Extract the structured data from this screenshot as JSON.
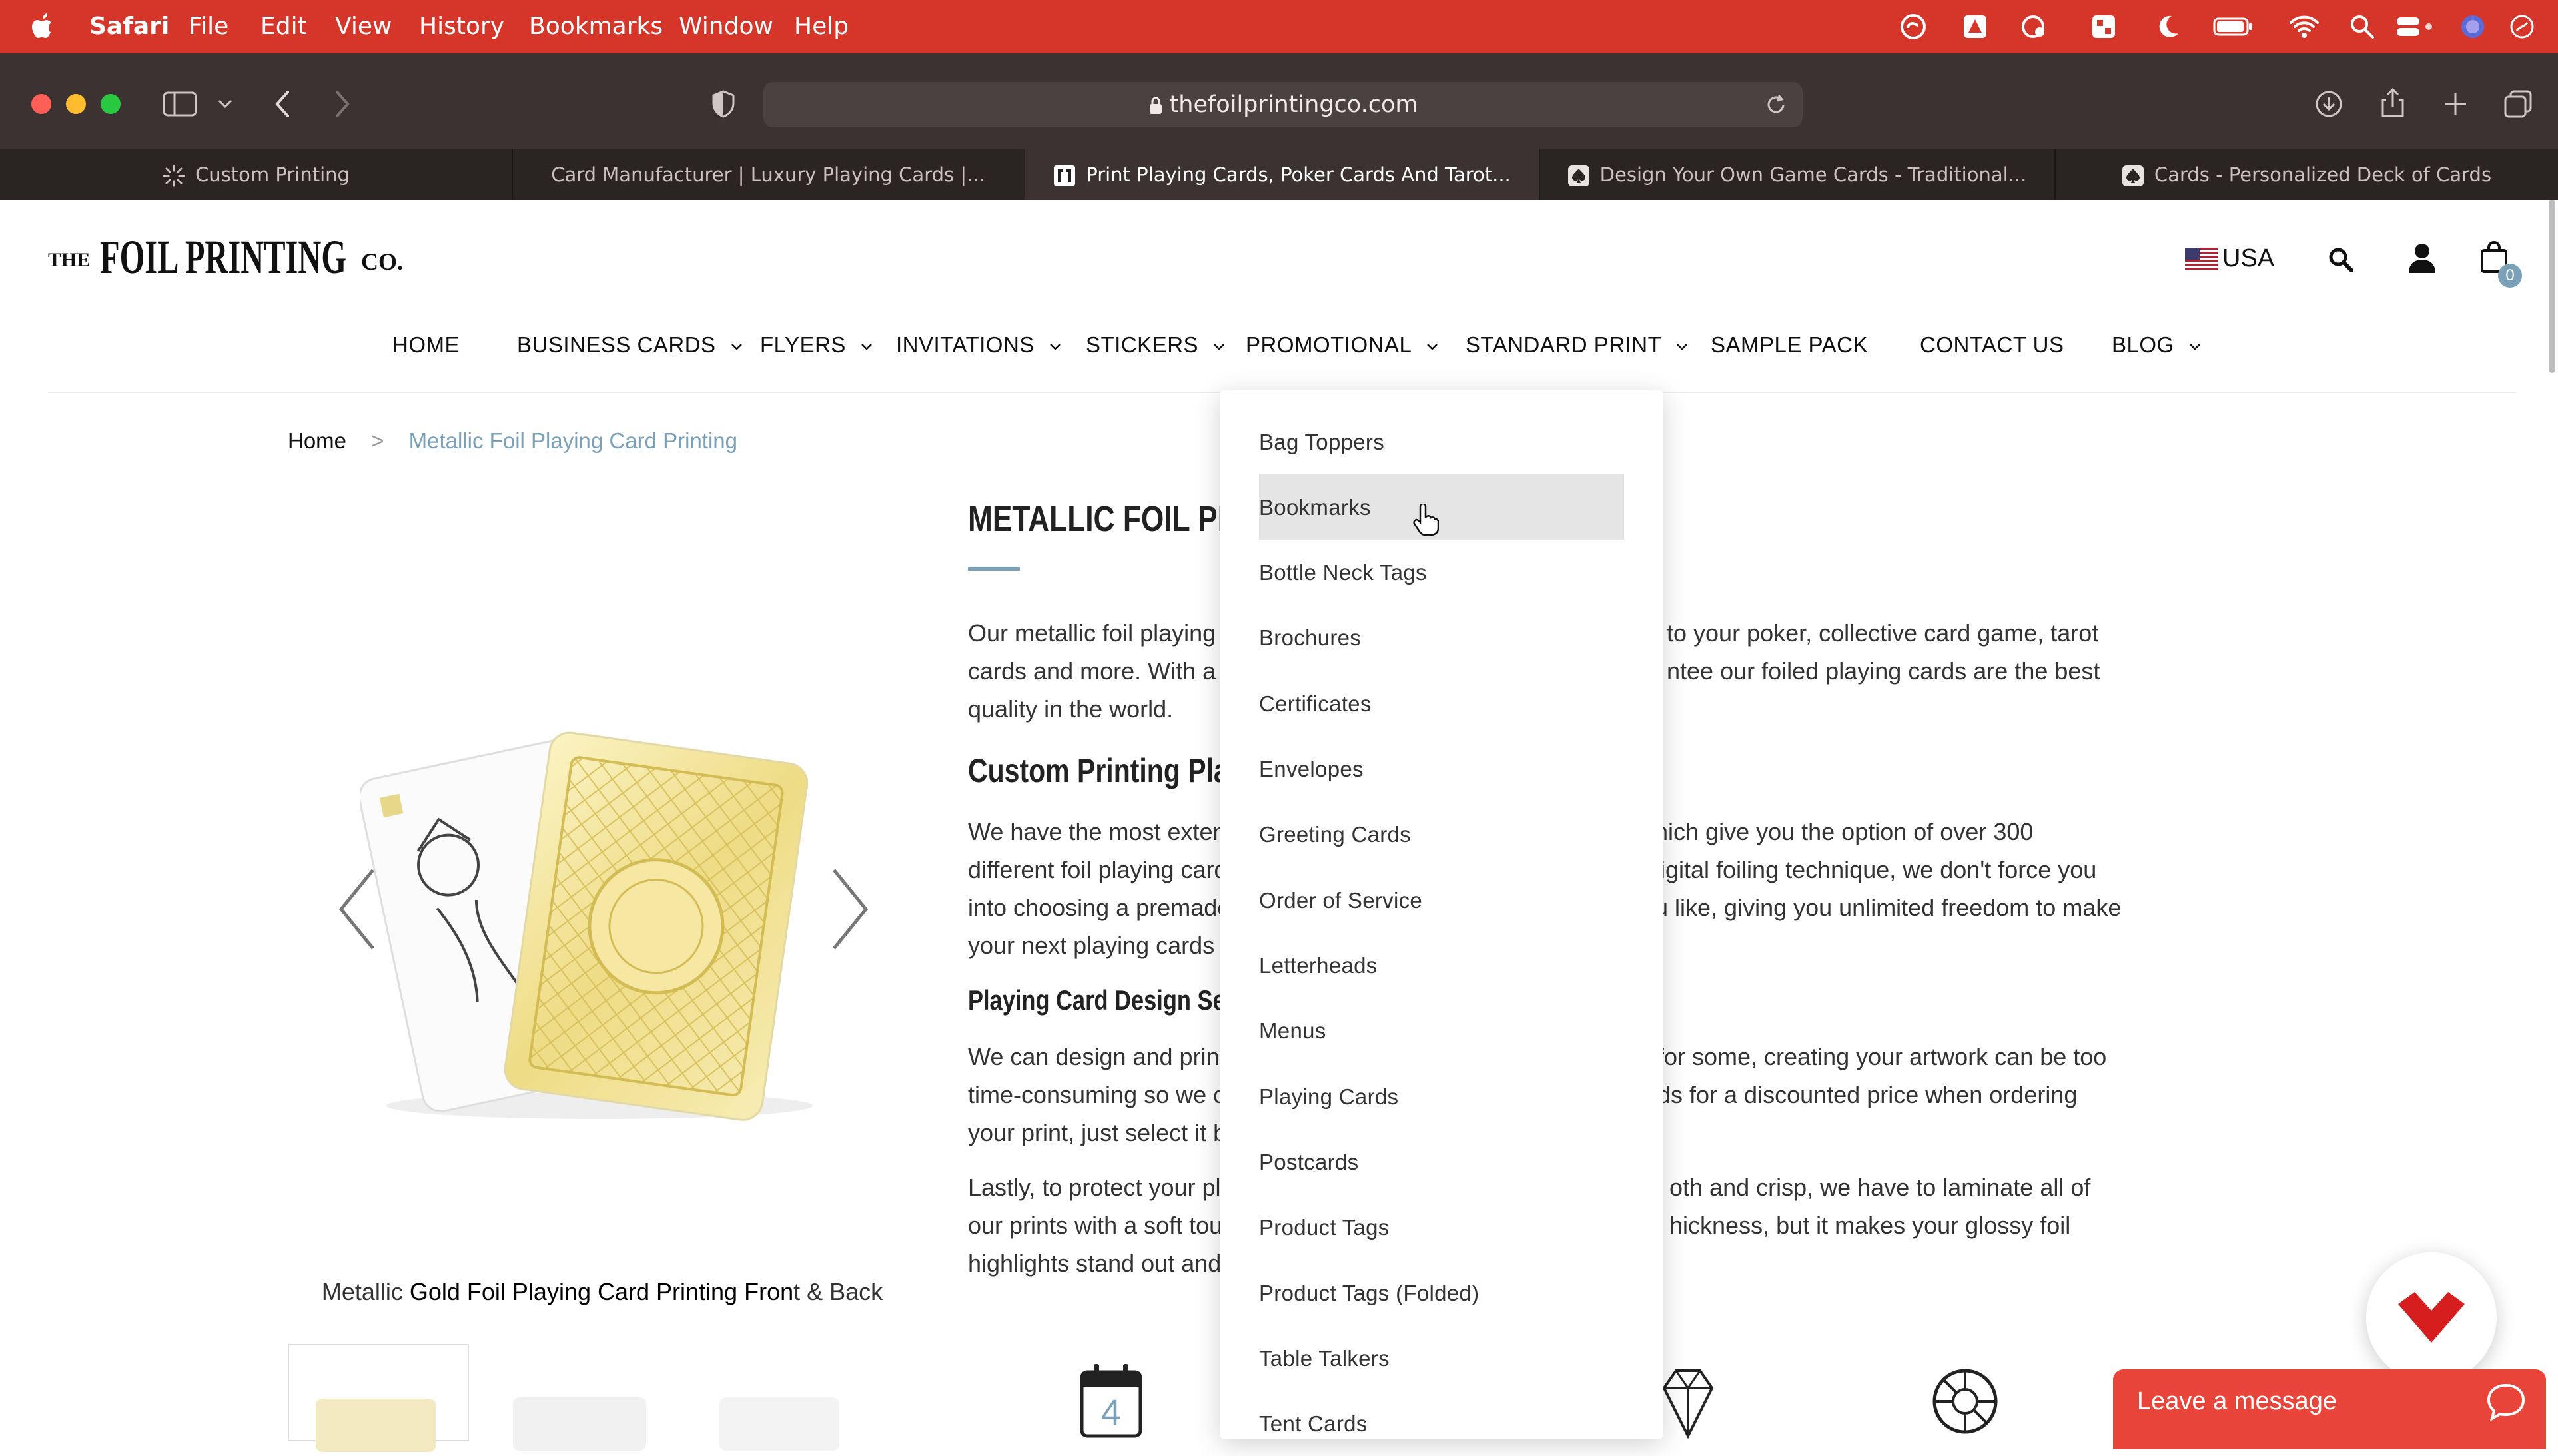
{
  "menubar": {
    "app": "Safari",
    "items": [
      "File",
      "Edit",
      "View",
      "History",
      "Bookmarks",
      "Window",
      "Help"
    ]
  },
  "browser": {
    "url": "thefoilprintingco.com",
    "tabs": [
      {
        "title": "Custom Printing",
        "icon": "spinner-icon"
      },
      {
        "title": "Card Manufacturer | Luxury Playing Cards |...",
        "icon": ""
      },
      {
        "title": "Print Playing Cards, Poker Cards And Tarot...",
        "icon": "site-favicon"
      },
      {
        "title": "Design Your Own Game Cards - Traditional...",
        "icon": "spade-icon"
      },
      {
        "title": "Cards - Personalized Deck of Cards",
        "icon": "spade-icon"
      }
    ]
  },
  "site": {
    "logo_text": "THE FOIL PRINTING CO.",
    "region": "USA",
    "cart_count": "0",
    "nav": [
      {
        "label": "HOME",
        "dropdown": false
      },
      {
        "label": "BUSINESS CARDS",
        "dropdown": true
      },
      {
        "label": "FLYERS",
        "dropdown": true
      },
      {
        "label": "INVITATIONS",
        "dropdown": true
      },
      {
        "label": "STICKERS",
        "dropdown": true
      },
      {
        "label": "PROMOTIONAL",
        "dropdown": true
      },
      {
        "label": "STANDARD PRINT",
        "dropdown": true
      },
      {
        "label": "SAMPLE PACK",
        "dropdown": false
      },
      {
        "label": "CONTACT US",
        "dropdown": false
      },
      {
        "label": "BLOG",
        "dropdown": true
      }
    ],
    "breadcrumb": {
      "home": "Home",
      "separator": ">",
      "current": "Metallic Foil Playing Card Printing"
    },
    "content": {
      "title": "METALLIC FOIL PLAYI",
      "p1_l1a": "Our metallic foil playing c",
      "p1_l1b": "to your poker, collective card game, tarot",
      "p1_l2a": "cards and more. With a t",
      "p1_l2b": "ntee our foiled playing cards are the best",
      "p1_l3": "quality in the world.",
      "h2a": "Custom Printing Playi",
      "p2_l1a": "We have the most extens",
      "p2_l1b": "hich give you the option of over 300",
      "p2_l2a": "different foil playing card",
      "p2_l2b": "ligital foiling technique, we don't force you",
      "p2_l3a": "into choosing a premade",
      "p2_l3b": "u like, giving you unlimited freedom to make",
      "p2_l4": "your next playing cards e",
      "h2b": "Playing Card Design Ser",
      "p3_l1a": "We can design and print",
      "p3_l1b": "for some, creating your artwork can be too",
      "p3_l2a": "time-consuming so we ca",
      "p3_l2b": "ds for a discounted price when ordering",
      "p3_l3": "your print, just select it b",
      "p4_l1a": "Lastly, to protect your pla",
      "p4_l1b": "oth and crisp, we have to laminate all of",
      "p4_l2a": "our prints with a soft tou",
      "p4_l2b": "hickness, but it makes your glossy foil",
      "p4_l3": "highlights stand out and",
      "calendar_day": "4"
    },
    "carousel": {
      "caption_pre": "Metallic ",
      "caption_bold": "Gold Foil Playing Card Printing Fron",
      "caption_post": "t & Back"
    },
    "promotional_menu": [
      "Bag Toppers",
      "Bookmarks",
      "Bottle Neck Tags",
      "Brochures",
      "Certificates",
      "Envelopes",
      "Greeting Cards",
      "Order of Service",
      "Letterheads",
      "Menus",
      "Playing Cards",
      "Postcards",
      "Product Tags",
      "Product Tags (Folded)",
      "Table Talkers",
      "Tent Cards"
    ],
    "chat_label": "Leave a message"
  },
  "colors": {
    "menubar": "#d6362a",
    "toolbar": "#3b3231",
    "breadcrumb_current": "#7aa1b8",
    "accent": "#7aa1b8",
    "chat": "#e8443a"
  }
}
